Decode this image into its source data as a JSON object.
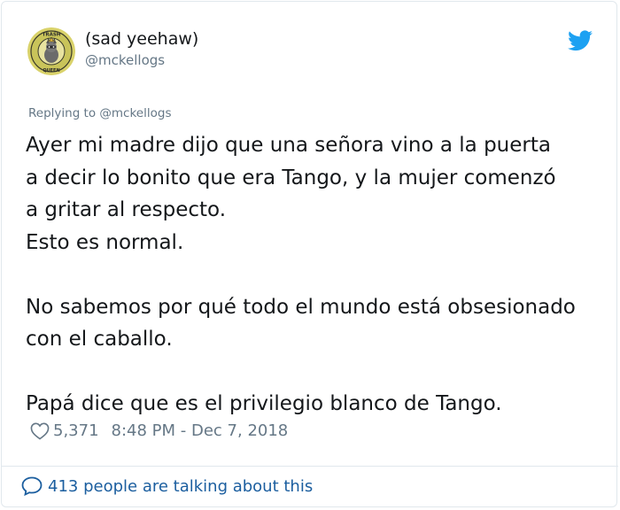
{
  "user": {
    "display_name": "(sad yeehaw)",
    "handle": "@mckellogs",
    "avatar_icon": "trash-queen-badge",
    "avatar_text_top": "TRASH",
    "avatar_text_bottom": "QUEEN"
  },
  "reply": {
    "text": "Replying to @mckellogs"
  },
  "tweet": {
    "lines": [
      "Ayer mi madre dijo que una señora vino a la puerta",
      "a decir lo bonito que era Tango, y la mujer comenzó",
      "a gritar al respecto.",
      "Esto es normal.",
      "",
      "No sabemos por qué todo el mundo está obsesionado",
      "con el caballo.",
      "",
      "Papá dice que es el privilegio blanco de Tango."
    ]
  },
  "meta": {
    "likes": "5,371",
    "timestamp": "8:48 PM - Dec 7, 2018"
  },
  "footer": {
    "talking_text": "413 people are talking about this"
  },
  "colors": {
    "twitter_blue": "#1da1f2",
    "link_blue": "#1b5e9f",
    "muted_gray": "#657786",
    "text": "#14171a"
  }
}
